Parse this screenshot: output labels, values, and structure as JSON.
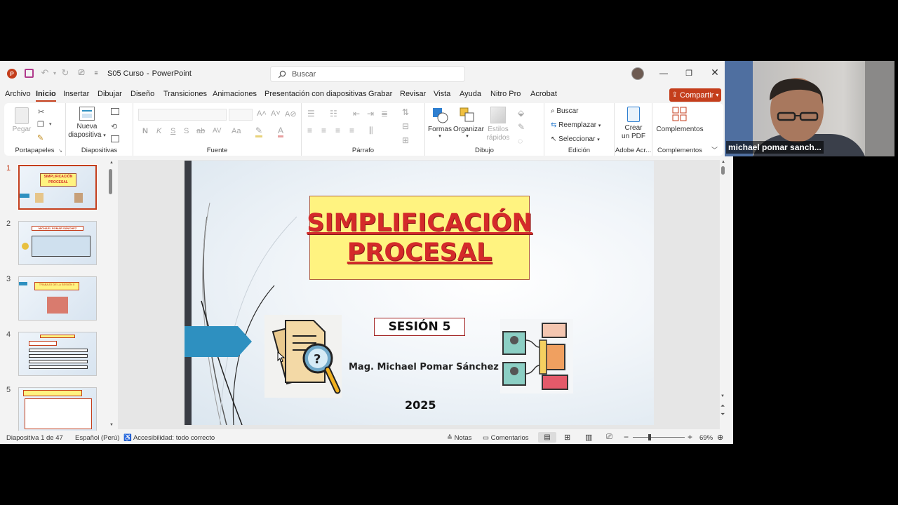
{
  "window": {
    "doc_title": "S05 Curso",
    "app_name": "PowerPoint",
    "separator": "-",
    "search_placeholder": "Buscar"
  },
  "menu": {
    "items": [
      "Archivo",
      "Inicio",
      "Insertar",
      "Dibujar",
      "Diseño",
      "Transiciones",
      "Animaciones",
      "Presentación con diapositivas",
      "Grabar",
      "Revisar",
      "Vista",
      "Ayuda",
      "Nitro Pro",
      "Acrobat"
    ],
    "active": "Inicio",
    "share_label": "Compartir"
  },
  "ribbon": {
    "portapapeles": {
      "label": "Portapapeles",
      "paste": "Pegar"
    },
    "diapositivas": {
      "label": "Diapositivas",
      "new_slide_1": "Nueva",
      "new_slide_2": "diapositiva"
    },
    "fuente": {
      "label": "Fuente",
      "bold": "N",
      "italic": "K",
      "underline": "S",
      "shadow": "S",
      "strike": "ab",
      "spacing": "AV",
      "case": "Aa"
    },
    "parrafo": {
      "label": "Párrafo"
    },
    "dibujo": {
      "label": "Dibujo",
      "shapes": "Formas",
      "arrange": "Organizar",
      "quick_styles_1": "Estilos",
      "quick_styles_2": "rápidos"
    },
    "edicion": {
      "label": "Edición",
      "find": "Buscar",
      "replace": "Reemplazar",
      "select": "Seleccionar"
    },
    "adobe": {
      "label": "Adobe Acr...",
      "create_1": "Crear",
      "create_2": "un PDF"
    },
    "complementos": {
      "label": "Complementos",
      "button": "Complementos"
    }
  },
  "thumbnails": [
    {
      "num": "1",
      "title": "SIMPLIFICACIÓN PROCESAL",
      "selected": true
    },
    {
      "num": "2",
      "title": "MICHAEL POMAR SÁNCHEZ",
      "selected": false
    },
    {
      "num": "3",
      "title": "TRABAJO DE LA SESIÓN 5",
      "selected": false
    },
    {
      "num": "4",
      "title": "",
      "selected": false
    },
    {
      "num": "5",
      "title": "",
      "selected": false
    }
  ],
  "slide": {
    "title_line1": "SIMPLIFICACIÓN",
    "title_line2": "PROCESAL",
    "session": "SESIÓN 5",
    "author": "Mag. Michael Pomar Sánchez",
    "year": "2025"
  },
  "status": {
    "slide_info": "Diapositiva 1 de 47",
    "language": "Español (Perú)",
    "accessibility": "Accesibilidad: todo correcto",
    "notes": "Notas",
    "comments": "Comentarios",
    "zoom": "69%",
    "zoom_level": 0.69
  },
  "video": {
    "participant_name": "michael pomar sanch..."
  },
  "colors": {
    "accent": "#c43e1c",
    "title_red": "#d42a2a",
    "title_box": "#fff380",
    "slide_arrow": "#2e90c0"
  }
}
